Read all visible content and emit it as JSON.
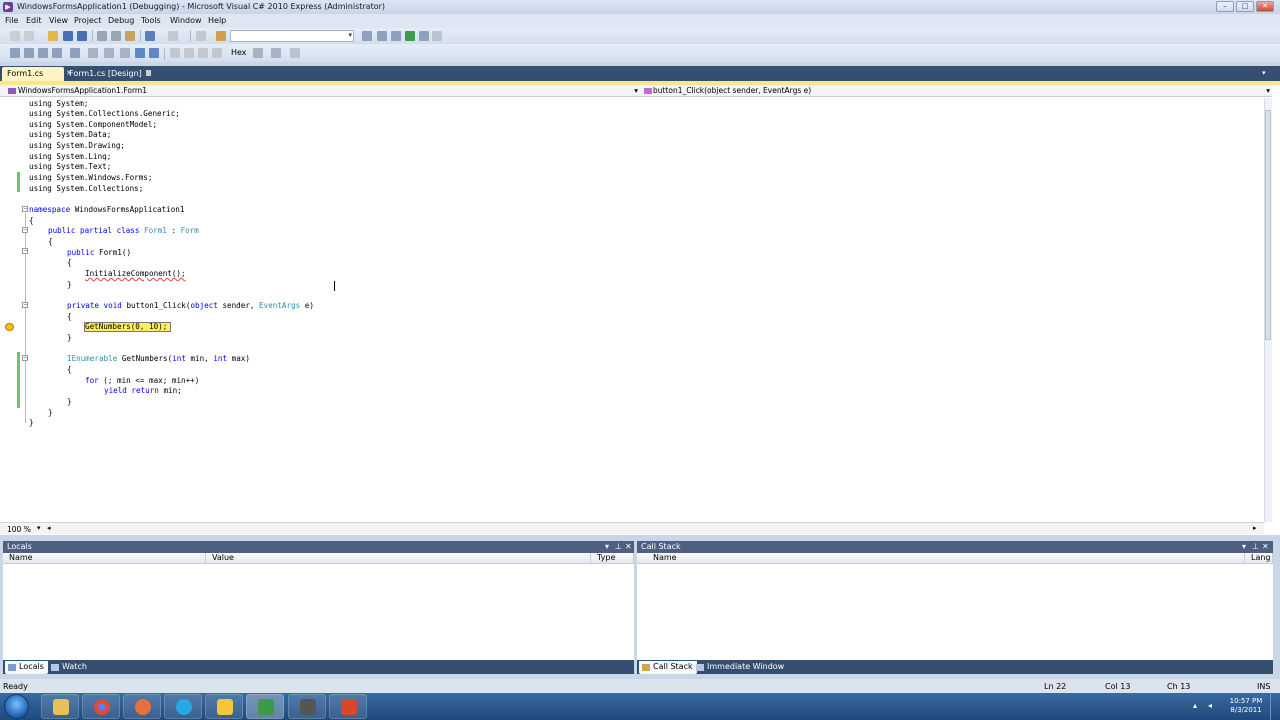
{
  "window": {
    "title": "WindowsFormsApplication1 (Debugging) - Microsoft Visual C# 2010 Express (Administrator)",
    "minimize": "–",
    "maximize": "□",
    "close": "✕"
  },
  "menu": [
    "File",
    "Edit",
    "View",
    "Project",
    "Debug",
    "Tools",
    "Window",
    "Help"
  ],
  "toolbar": {
    "hex_label": "Hex"
  },
  "doc_tabs": [
    {
      "label": "Form1.cs",
      "close": "✕"
    },
    {
      "label": "Form1.cs [Design]"
    }
  ],
  "nav": {
    "class_combo": "WindowsFormsApplication1.Form1",
    "member_combo": "button1_Click(object sender, EventArgs e)"
  },
  "code": {
    "l1": "using System;",
    "l2": "using System.Collections.Generic;",
    "l3": "using System.ComponentModel;",
    "l4": "using System.Data;",
    "l5": "using System.Drawing;",
    "l6": "using System.Linq;",
    "l7": "using System.Text;",
    "l8": "using System.Windows.Forms;",
    "l9": "using System.Collections;",
    "l11_kw": "namespace",
    "l11_rest": " WindowsFormsApplication1",
    "l12": "{",
    "l13_kw": "public partial class",
    "l13_ty": "Form1",
    "l13_sep": " : ",
    "l13_ty2": "Form",
    "l14": "{",
    "l15_kw": "public",
    "l15_rest": " Form1()",
    "l16": "{",
    "l17": "InitializeComponent();",
    "l18": "}",
    "l20_kw": "private void",
    "l20_rest": " button1_Click(",
    "l20_kw2": "object",
    "l20_rest2": " sender, ",
    "l20_ty": "EventArgs",
    "l20_rest3": " e)",
    "l21": "{",
    "l22": "GetNumbers(0, 10);",
    "l23": "}",
    "l25_ty": "IEnumerable",
    "l25_rest": " GetNumbers(",
    "l25_kw": "int",
    "l25_rest2": " min, ",
    "l25_kw2": "int",
    "l25_rest3": " max)",
    "l26": "{",
    "l27_kw": "for",
    "l27_rest": " (; min <= max; min++)",
    "l28_kw": "yield return",
    "l28_rest": " min;",
    "l29": "}",
    "l30": "}",
    "l31": "}"
  },
  "zoom": "100 %",
  "locals": {
    "title": "Locals",
    "columns": [
      "Name",
      "Value",
      "Type"
    ],
    "tabs": [
      "Locals",
      "Watch"
    ]
  },
  "callstack": {
    "title": "Call Stack",
    "columns": [
      "Name",
      "Lang"
    ],
    "tabs": [
      "Call Stack",
      "Immediate Window"
    ]
  },
  "status": {
    "ready": "Ready",
    "ln": "Ln 22",
    "col": "Col 13",
    "ch": "Ch 13",
    "ins": "INS"
  },
  "clock": {
    "time": "10:57 PM",
    "date": "8/3/2011"
  },
  "colors": {
    "keyword": "#0000ff",
    "type": "#2b91af",
    "current_statement": "#ffee62",
    "tab_bar": "#364e6f"
  }
}
